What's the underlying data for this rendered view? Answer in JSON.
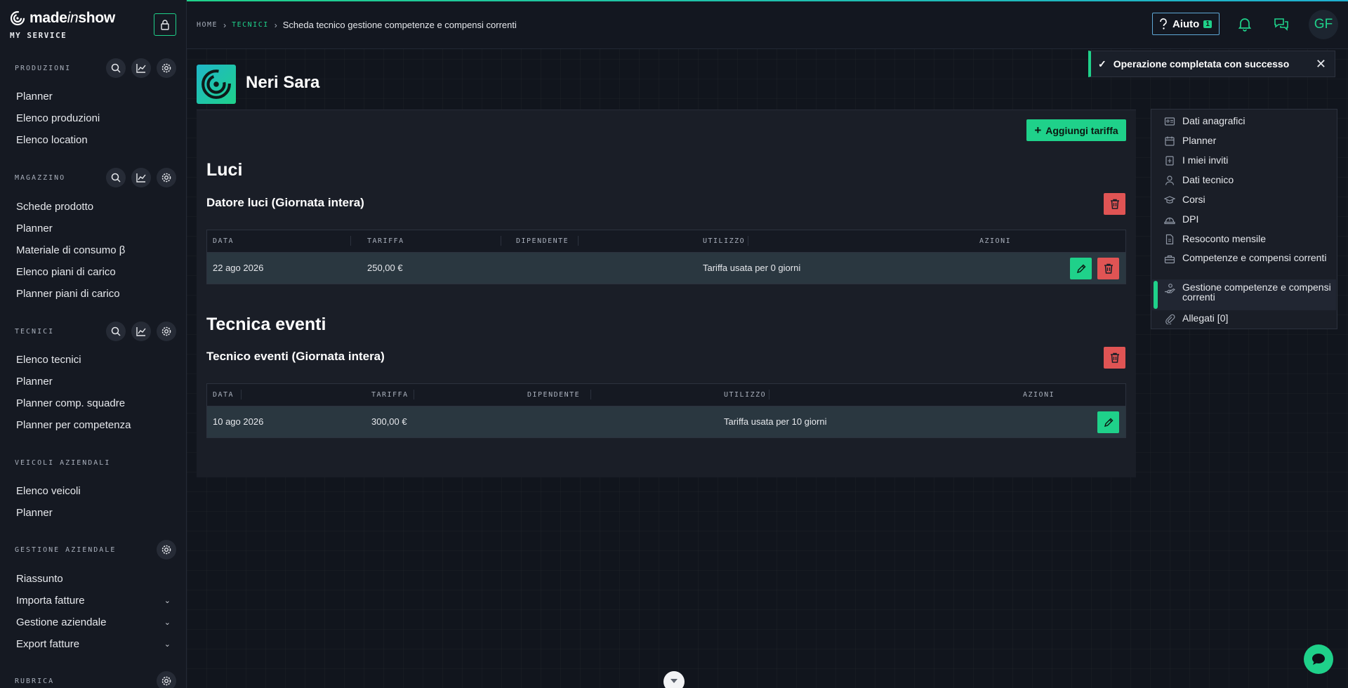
{
  "brand": {
    "name_prefix": "made",
    "name_italic": "in",
    "name_suffix": "show",
    "subtitle": "MY SERVICE"
  },
  "sidebar": {
    "sections": [
      {
        "title": "PRODUZIONI",
        "items": [
          "Planner",
          "Elenco produzioni",
          "Elenco location"
        ]
      },
      {
        "title": "MAGAZZINO",
        "items": [
          "Schede prodotto",
          "Planner",
          "Materiale di consumo β",
          "Elenco piani di carico",
          "Planner piani di carico"
        ]
      },
      {
        "title": "TECNICI",
        "items": [
          "Elenco tecnici",
          "Planner",
          "Planner comp. squadre",
          "Planner per competenza"
        ]
      },
      {
        "title": "VEICOLI AZIENDALI",
        "items": [
          "Elenco veicoli",
          "Planner"
        ]
      },
      {
        "title": "GESTIONE AZIENDALE",
        "items": [
          "Riassunto",
          "Importa fatture",
          "Gestione aziendale",
          "Export fatture"
        ]
      },
      {
        "title": "RUBRICA",
        "items": []
      }
    ]
  },
  "breadcrumb": {
    "home": "HOME",
    "tecnici": "TECNICI",
    "current": "Scheda tecnico gestione competenze e compensi correnti"
  },
  "topbar": {
    "help_label": "Aiuto",
    "help_badge": "1",
    "avatar_initials": "GF"
  },
  "page": {
    "title": "Neri Sara"
  },
  "toast": {
    "message": "Operazione completata con successo"
  },
  "actions": {
    "add_rate": "Aggiungi tariffa"
  },
  "table_headers": {
    "data": "DATA",
    "tariffa": "TARIFFA",
    "dipendente": "DIPENDENTE",
    "utilizzo": "UTILIZZO",
    "azioni": "AZIONI"
  },
  "categories": [
    {
      "title": "Luci",
      "subtitle": "Datore luci (Giornata intera)",
      "rows": [
        {
          "data": "22 ago 2026",
          "tariffa": "250,00 €",
          "dipendente": "",
          "utilizzo": "Tariffa usata per 0 giorni"
        }
      ]
    },
    {
      "title": "Tecnica eventi",
      "subtitle": "Tecnico eventi (Giornata intera)",
      "rows": [
        {
          "data": "10 ago 2026",
          "tariffa": "300,00 €",
          "dipendente": "",
          "utilizzo": "Tariffa usata per 10 giorni"
        }
      ]
    }
  ],
  "right_nav": {
    "items": [
      {
        "label": "Dati anagrafici",
        "icon": "id-card-icon"
      },
      {
        "label": "Planner",
        "icon": "calendar-icon"
      },
      {
        "label": "I miei inviti",
        "icon": "invite-icon"
      },
      {
        "label": "Dati tecnico",
        "icon": "user-icon"
      },
      {
        "label": "Corsi",
        "icon": "graduation-cap-icon"
      },
      {
        "label": "DPI",
        "icon": "helmet-icon"
      },
      {
        "label": "Resoconto mensile",
        "icon": "document-icon"
      },
      {
        "label": "Competenze e compensi correnti",
        "icon": "toolbox-icon"
      },
      {
        "label": "Gestione competenze e compensi correnti",
        "icon": "hand-coin-icon",
        "active": true
      },
      {
        "label": "Allegati [0]",
        "icon": "paperclip-icon"
      }
    ]
  },
  "colors": {
    "accent": "#1fd18a",
    "danger": "#e05454",
    "background": "#11151d",
    "panel": "#1a1e27"
  }
}
